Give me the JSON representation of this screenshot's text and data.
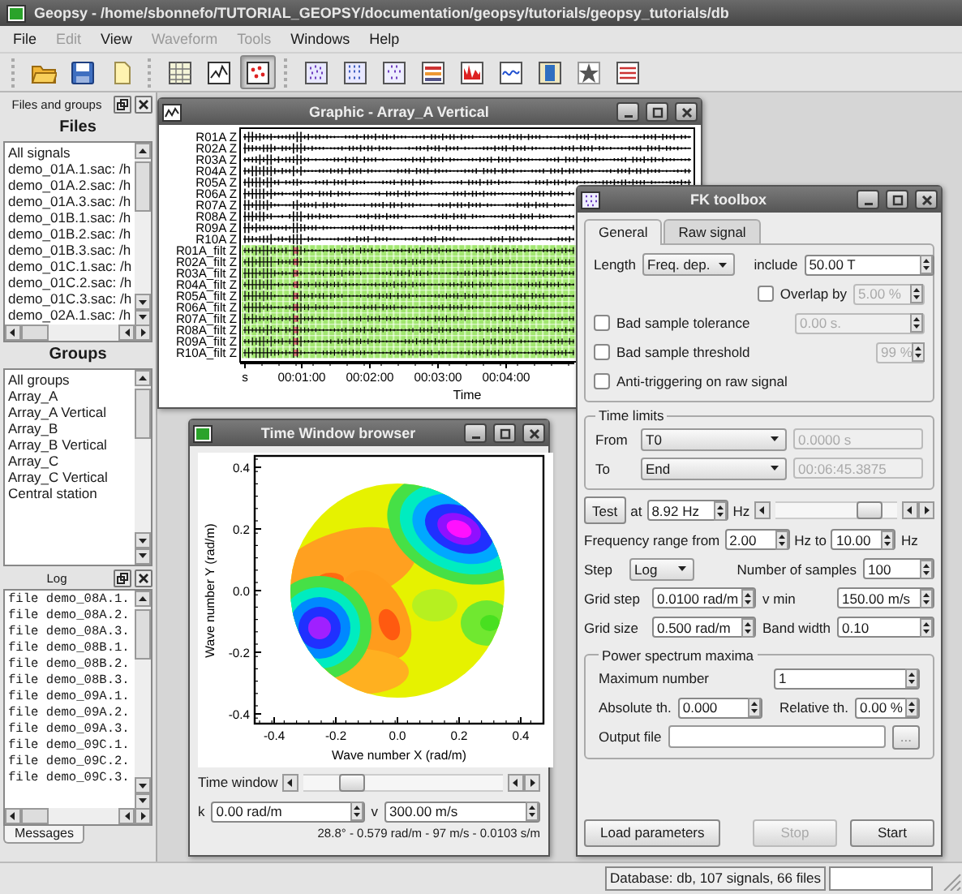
{
  "window": {
    "title": "Geopsy - /home/sbonnefo/TUTORIAL_GEOPSY/documentation/geopsy/tutorials/geopsy_tutorials/db"
  },
  "menu": [
    {
      "label": "File",
      "disabled": false
    },
    {
      "label": "Edit",
      "disabled": true
    },
    {
      "label": "View",
      "disabled": false
    },
    {
      "label": "Waveform",
      "disabled": true
    },
    {
      "label": "Tools",
      "disabled": true
    },
    {
      "label": "Windows",
      "disabled": false
    },
    {
      "label": "Help",
      "disabled": false
    }
  ],
  "toolbar": [
    {
      "buttons": [
        {
          "selected": false
        },
        {
          "selected": false
        },
        {
          "selected": false
        }
      ]
    },
    {
      "buttons": [
        {
          "selected": false
        },
        {
          "selected": false
        },
        {
          "selected": true
        }
      ]
    },
    {
      "buttons": [
        {
          "selected": false
        },
        {
          "selected": false
        },
        {
          "selected": false
        },
        {
          "selected": false
        },
        {
          "selected": false
        },
        {
          "selected": false
        },
        {
          "selected": false
        },
        {
          "selected": false
        },
        {
          "selected": false
        }
      ]
    }
  ],
  "files_dock": {
    "title": "Files and groups",
    "files_heading": "Files",
    "files": [
      "All signals",
      "demo_01A.1.sac: /h",
      "demo_01A.2.sac: /h",
      "demo_01A.3.sac: /h",
      "demo_01B.1.sac: /h",
      "demo_01B.2.sac: /h",
      "demo_01B.3.sac: /h",
      "demo_01C.1.sac: /h",
      "demo_01C.2.sac: /h",
      "demo_01C.3.sac: /h",
      "demo_02A.1.sac: /h"
    ],
    "groups_heading": "Groups",
    "groups": [
      "All groups",
      "Array_A",
      "Array_A Vertical",
      "Array_B",
      "Array_B Vertical",
      "Array_C",
      "Array_C Vertical",
      "Central station"
    ]
  },
  "log_dock": {
    "title": "Log",
    "lines": [
      "file demo_08A.1.",
      "file demo_08A.2.",
      "file demo_08A.3.",
      "file demo_08B.1.",
      "file demo_08B.2.",
      "file demo_08B.3.",
      "file demo_09A.1.",
      "file demo_09A.2.",
      "file demo_09A.3.",
      "file demo_09C.1.",
      "file demo_09C.2.",
      "file demo_09C.3."
    ],
    "tabs": [
      {
        "label": "Messages",
        "selected": true
      }
    ]
  },
  "graphic_window": {
    "title": "Graphic - Array_A Vertical",
    "traces": [
      {
        "label": "R01A Z",
        "kind": "raw"
      },
      {
        "label": "R02A Z",
        "kind": "raw"
      },
      {
        "label": "R03A Z",
        "kind": "raw"
      },
      {
        "label": "R04A Z",
        "kind": "raw"
      },
      {
        "label": "R05A Z",
        "kind": "raw"
      },
      {
        "label": "R06A Z",
        "kind": "raw"
      },
      {
        "label": "R07A Z",
        "kind": "raw"
      },
      {
        "label": "R08A Z",
        "kind": "raw"
      },
      {
        "label": "R09A Z",
        "kind": "raw"
      },
      {
        "label": "R10A Z",
        "kind": "raw"
      },
      {
        "label": "R01A_filt Z",
        "kind": "filtered"
      },
      {
        "label": "R02A_filt Z",
        "kind": "filtered"
      },
      {
        "label": "R03A_filt Z",
        "kind": "filtered"
      },
      {
        "label": "R04A_filt Z",
        "kind": "filtered"
      },
      {
        "label": "R05A_filt Z",
        "kind": "filtered"
      },
      {
        "label": "R06A_filt Z",
        "kind": "filtered"
      },
      {
        "label": "R07A_filt Z",
        "kind": "filtered"
      },
      {
        "label": "R08A_filt Z",
        "kind": "filtered"
      },
      {
        "label": "R09A_filt Z",
        "kind": "filtered"
      },
      {
        "label": "R10A_filt Z",
        "kind": "filtered"
      }
    ],
    "xticks": [
      "s",
      "00:01:00",
      "00:02:00",
      "00:03:00",
      "00:04:00"
    ],
    "xlabel": "Time"
  },
  "time_window_browser": {
    "title": "Time Window browser",
    "xlabel": "Wave number X (rad/m)",
    "ylabel": "Wave number Y (rad/m)",
    "xticks": [
      "-0.4",
      "-0.2",
      "0.0",
      "0.2",
      "0.4"
    ],
    "yticks": [
      "0.4",
      "0.2",
      "0.0",
      "-0.2",
      "-0.4"
    ],
    "time_window": {
      "label": "Time window",
      "level": 0.2
    },
    "k": {
      "label": "k",
      "value": "0.00 rad/m"
    },
    "v": {
      "label": "v",
      "value": "300.00 m/s"
    },
    "readout": "28.8° - 0.579 rad/m - 97 m/s - 0.0103 s/m"
  },
  "fk_toolbox": {
    "title": "FK toolbox",
    "tabs": [
      {
        "label": "General",
        "selected": true
      },
      {
        "label": "Raw signal",
        "selected": false
      }
    ],
    "length": {
      "label": "Length",
      "value": "Freq. dep."
    },
    "include": {
      "label": "include",
      "value": "50.00 T"
    },
    "options": [
      {
        "kind": "inline",
        "label": "Overlap by",
        "checked": false,
        "value": "5.00 %"
      },
      {
        "kind": "wide",
        "label": "Bad sample tolerance",
        "checked": false,
        "value": "0.00 s."
      },
      {
        "kind": "narrow",
        "label": "Bad sample threshold",
        "checked": false,
        "value": "99 %"
      },
      {
        "kind": "plain",
        "label": "Anti-triggering on raw signal",
        "checked": false
      }
    ],
    "time_limits": {
      "title": "Time limits",
      "rows": [
        {
          "label": "From",
          "choice": "T0",
          "value": "0.0000 s",
          "disabled": true
        },
        {
          "label": "To",
          "choice": "End",
          "value": "00:06:45.3875",
          "disabled": true
        }
      ]
    },
    "test": {
      "button": "Test",
      "at": "at",
      "value": "8.92 Hz",
      "unit": "Hz",
      "level": 0.85
    },
    "frequency": {
      "label": "Frequency range from",
      "from": "2.00",
      "to_label": "Hz to",
      "to": "10.00",
      "unit": "Hz"
    },
    "step": {
      "label": "Step",
      "value": "Log"
    },
    "samples": {
      "label": "Number of samples",
      "value": "100"
    },
    "grid_step": {
      "label": "Grid step",
      "value": "0.0100 rad/m"
    },
    "v_min": {
      "label": "v min",
      "value": "150.00 m/s"
    },
    "grid_size": {
      "label": "Grid size",
      "value": "0.500 rad/m"
    },
    "band_width": {
      "label": "Band width",
      "value": "0.10"
    },
    "maxima": {
      "title": "Power spectrum maxima",
      "max_number": {
        "label": "Maximum number",
        "value": "1"
      },
      "absolute": {
        "label": "Absolute th.",
        "value": "0.000"
      },
      "relative": {
        "label": "Relative th.",
        "value": "0.00 %"
      },
      "output": {
        "label": "Output file",
        "button": "..."
      }
    },
    "buttons": [
      {
        "label": "Load parameters",
        "disabled": false
      },
      {
        "label": "Stop",
        "disabled": true
      },
      {
        "label": "Start",
        "disabled": false
      }
    ]
  },
  "status_bar": {
    "text": "Database: db, 107 signals, 66 files"
  }
}
